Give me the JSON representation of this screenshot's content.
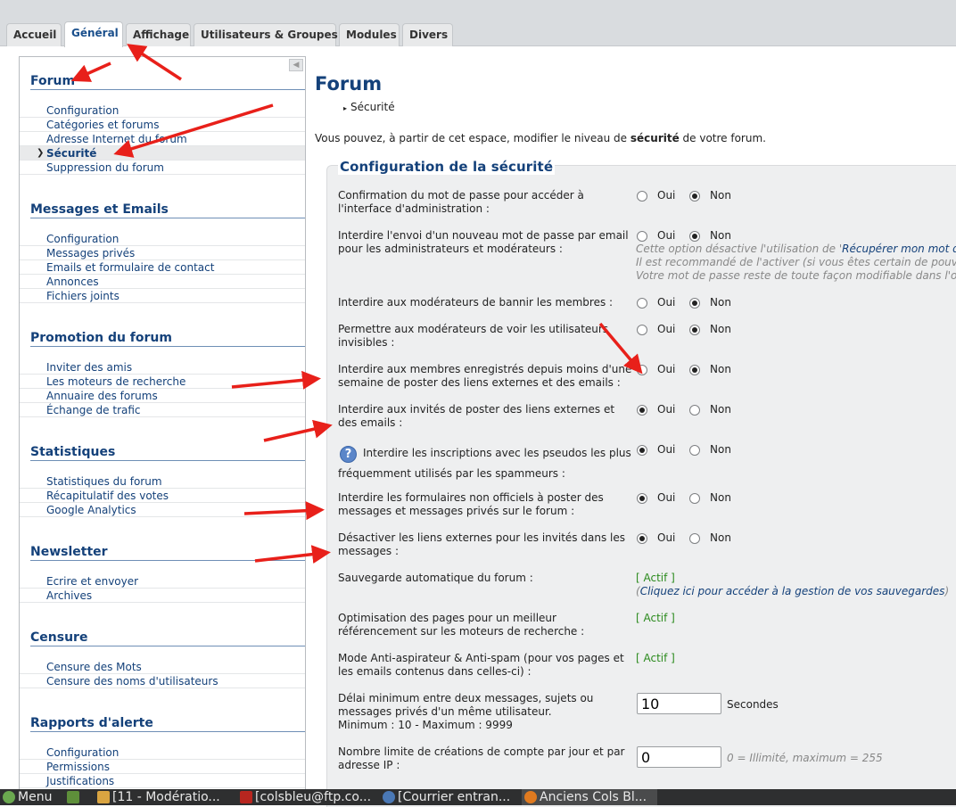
{
  "tabs": [
    {
      "label": "Accueil",
      "active": false
    },
    {
      "label": "Général",
      "active": true
    },
    {
      "label": "Affichage",
      "active": false
    },
    {
      "label": "Utilisateurs & Groupes",
      "active": false
    },
    {
      "label": "Modules",
      "active": false
    },
    {
      "label": "Divers",
      "active": false
    }
  ],
  "sidebar": {
    "collapse_glyph": "◀",
    "sections": [
      {
        "title": "Forum",
        "items": [
          "Configuration",
          "Catégories et forums",
          "Adresse Internet du forum",
          "Sécurité",
          "Suppression du forum"
        ]
      },
      {
        "title": "Messages et Emails",
        "items": [
          "Configuration",
          "Messages privés",
          "Emails et formulaire de contact",
          "Annonces",
          "Fichiers joints"
        ]
      },
      {
        "title": "Promotion du forum",
        "items": [
          "Inviter des amis",
          "Les moteurs de recherche",
          "Annuaire des forums",
          "Échange de trafic"
        ]
      },
      {
        "title": "Statistiques",
        "items": [
          "Statistiques du forum",
          "Récapitulatif des votes",
          "Google Analytics"
        ]
      },
      {
        "title": "Newsletter",
        "items": [
          "Ecrire et envoyer",
          "Archives"
        ]
      },
      {
        "title": "Censure",
        "items": [
          "Censure des Mots",
          "Censure des noms d'utilisateurs"
        ]
      },
      {
        "title": "Rapports d'alerte",
        "items": [
          "Configuration",
          "Permissions",
          "Justifications"
        ]
      }
    ],
    "active_item": "Sécurité"
  },
  "main": {
    "title": "Forum",
    "breadcrumb": "Sécurité",
    "intro_before": "Vous pouvez, à partir de cet espace, modifier le niveau de ",
    "intro_bold": "sécurité",
    "intro_after": " de votre forum.",
    "panel_title": "Configuration de la sécurité",
    "yes_label": "Oui",
    "no_label": "Non",
    "settings": [
      {
        "label": "Confirmation du mot de passe pour accéder à l'interface d'administration :",
        "value": "Non"
      },
      {
        "label": "Interdire l'envoi d'un nouveau mot de passe par email pour les administrateurs et modérateurs :",
        "value": "Non",
        "note_lines": [
          "Cette option désactive l'utilisation de '",
          "Récupérer mon mot de p",
          "Il est recommandé de l'activer (si vous êtes certain de pouvoir",
          "Votre mot de passe reste de toute façon modifiable dans l'ong"
        ]
      },
      {
        "label": "Interdire aux modérateurs de bannir les membres :",
        "value": "Non"
      },
      {
        "label": "Permettre aux modérateurs de voir les utilisateurs invisibles :",
        "value": "Non"
      },
      {
        "label": "Interdire aux membres enregistrés depuis moins d'une semaine de poster des liens externes et des emails :",
        "value": "Non"
      },
      {
        "label": "Interdire aux invités de poster des liens externes et des emails :",
        "value": "Oui"
      },
      {
        "label": "Interdire les inscriptions avec les pseudos les plus fréquemment utilisés par les spammeurs :",
        "value": "Oui",
        "help": "?"
      },
      {
        "label": "Interdire les formulaires non officiels à poster des messages et messages privés sur le forum :",
        "value": "Oui"
      },
      {
        "label": "Désactiver les liens externes pour les invités dans les messages :",
        "value": "Oui"
      }
    ],
    "auto_backup": {
      "label": "Sauvegarde automatique du forum :",
      "status": "[ Actif ]",
      "link_open": "(",
      "link_text": "Cliquez ici pour accéder à la gestion de vos sauvegardes",
      "link_close": ")"
    },
    "seo": {
      "label": "Optimisation des pages pour un meilleur référencement sur les moteurs de recherche :",
      "status": "[ Actif ]"
    },
    "antispam": {
      "label": "Mode Anti-aspirateur & Anti-spam (pour vos pages et les emails contenus dans celles-ci) :",
      "status": "[ Actif ]"
    },
    "delay": {
      "label_line1": "Délai minimum entre deux messages, sujets ou",
      "label_line2": "messages privés d'un même utilisateur.",
      "label_line3": "Minimum : 10 - Maximum : 9999",
      "value": "10",
      "unit": "Secondes"
    },
    "account_limit": {
      "label": "Nombre limite de créations de compte par jour et par adresse IP :",
      "value": "0",
      "hint": "0 = Illimité, maximum = 255"
    }
  },
  "taskbar": [
    {
      "label": "Menu",
      "icon": "mint-menu-icon",
      "color": "#6aa84f"
    },
    {
      "label": "",
      "icon": "terminal-icon",
      "color": "#5e8f3a"
    },
    {
      "label": "[11 - Modératio...",
      "icon": "text-editor-icon",
      "color": "#d9a441"
    },
    {
      "label": "[colsbleu@ftp.co...",
      "icon": "filezilla-icon",
      "color": "#b7261f"
    },
    {
      "label": "[Courrier entran...",
      "icon": "thunderbird-icon",
      "color": "#4a78b5"
    },
    {
      "label": "Anciens Cols Bl...",
      "icon": "firefox-icon",
      "color": "#e07a1f"
    }
  ],
  "colors": {
    "link": "#14417a",
    "active_status": "#2a8a1c",
    "annotation_arrow": "#e8201a"
  }
}
